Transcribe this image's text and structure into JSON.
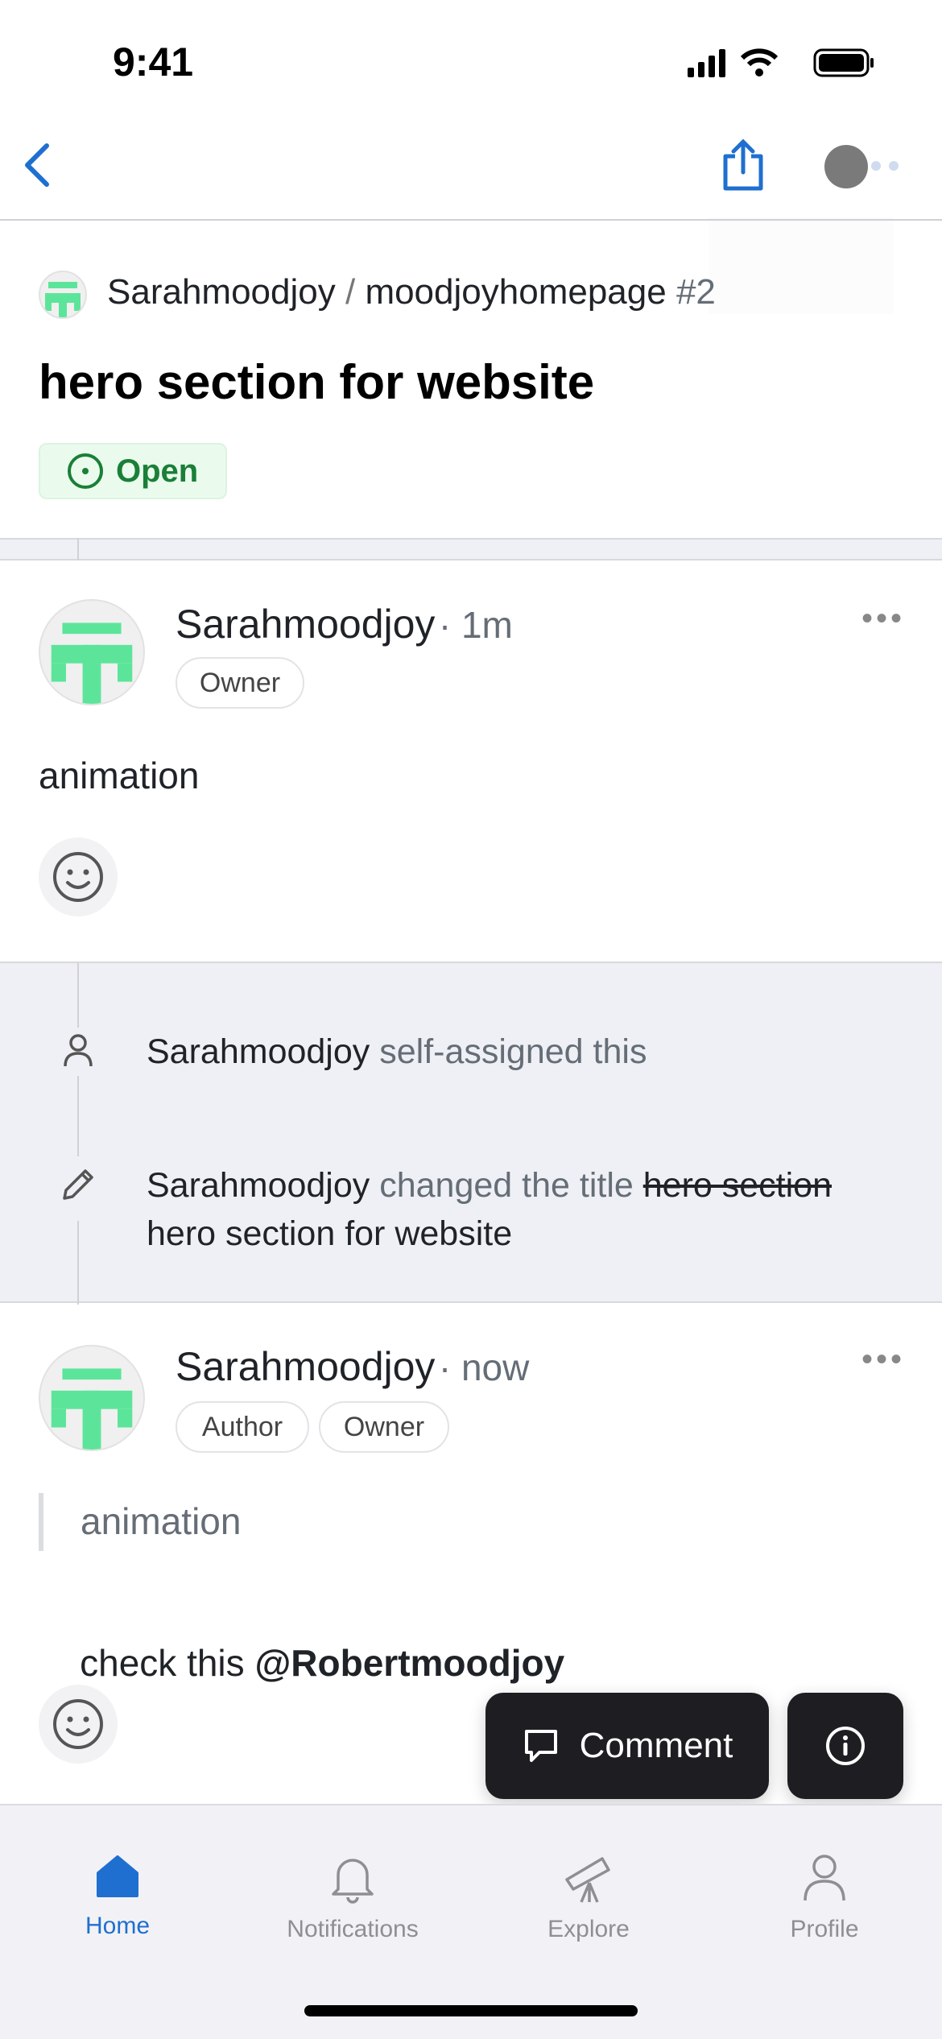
{
  "status_bar": {
    "time": "9:41"
  },
  "nav": {
    "back": "chevron-left-icon",
    "share": "share-icon",
    "more": "more-icon"
  },
  "issue": {
    "owner": "Sarahmoodjoy",
    "separator": "/",
    "repo": "moodjoyhomepage",
    "number": "#2",
    "title": "hero section for website",
    "state": "Open",
    "state_color": "#1a7f37"
  },
  "comments": [
    {
      "author": "Sarahmoodjoy",
      "time": "· 1m",
      "badges": [
        "Owner"
      ],
      "body": "animation"
    },
    {
      "author": "Sarahmoodjoy",
      "time": "· now",
      "badges": [
        "Author",
        "Owner"
      ],
      "quote": "animation",
      "body_prefix": "check this ",
      "mention": "@Robertmoodjoy"
    }
  ],
  "timeline": [
    {
      "icon": "person-icon",
      "actor": "Sarahmoodjoy",
      "text": " self-assigned this"
    },
    {
      "icon": "pencil-icon",
      "actor": "Sarahmoodjoy",
      "text": " changed the title ",
      "old_title": "hero section",
      "new_title": "hero section for website"
    }
  ],
  "actions": {
    "comment": "Comment",
    "info": "info-icon"
  },
  "tabs": [
    {
      "label": "Home",
      "icon": "home-icon",
      "active": true
    },
    {
      "label": "Notifications",
      "icon": "bell-icon"
    },
    {
      "label": "Explore",
      "icon": "telescope-icon"
    },
    {
      "label": "Profile",
      "icon": "person-icon"
    }
  ],
  "colors": {
    "accent": "#1f6fd0",
    "avatar_green": "#5ce59a",
    "open_bg": "#eafbee"
  }
}
